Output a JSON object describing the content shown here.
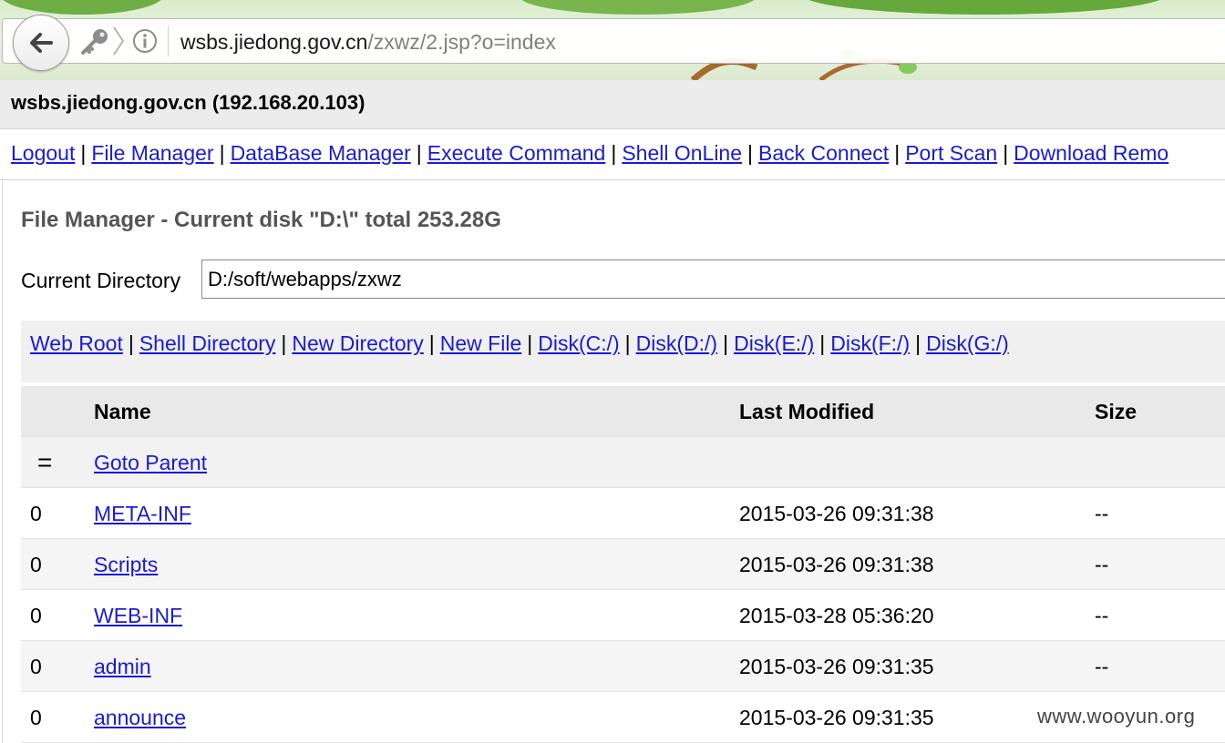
{
  "browser": {
    "url_host": "wsbs.jiedong.gov.cn",
    "url_path": "/zxwz/2.jsp?o=index"
  },
  "host_header": "wsbs.jiedong.gov.cn (192.168.20.103)",
  "nav": {
    "items": [
      "Logout",
      "File Manager",
      "DataBase Manager",
      "Execute Command",
      "Shell OnLine",
      "Back Connect",
      "Port Scan",
      "Download Remo"
    ],
    "separator": "|"
  },
  "file_manager": {
    "title": "File Manager - Current disk \"D:\\\" total 253.28G",
    "current_dir_label": "Current Directory",
    "current_dir_value": "D:/soft/webapps/zxwz",
    "quick_links": [
      "Web Root",
      "Shell Directory",
      "New Directory",
      "New File",
      "Disk(C:/)",
      "Disk(D:/)",
      "Disk(E:/)",
      "Disk(F:/)",
      "Disk(G:/)"
    ],
    "columns": {
      "name": "Name",
      "modified": "Last Modified",
      "size": "Size"
    },
    "parent": {
      "mark": "=",
      "label": "Goto Parent"
    },
    "rows": [
      {
        "mark": "0",
        "name": "META-INF",
        "modified": "2015-03-26 09:31:38",
        "size": "--"
      },
      {
        "mark": "0",
        "name": "Scripts",
        "modified": "2015-03-26 09:31:38",
        "size": "--"
      },
      {
        "mark": "0",
        "name": "WEB-INF",
        "modified": "2015-03-28 05:36:20",
        "size": "--"
      },
      {
        "mark": "0",
        "name": "admin",
        "modified": "2015-03-26 09:31:35",
        "size": "--"
      },
      {
        "mark": "0",
        "name": "announce",
        "modified": "2015-03-26 09:31:35",
        "size": ""
      }
    ]
  },
  "watermark": "www.wooyun.org",
  "icons": [
    "back-arrow-icon",
    "key-icon",
    "chevron-right-icon",
    "info-icon"
  ],
  "colors": {
    "link": "#1a1adb",
    "title_gray": "#555555",
    "header_bg": "#ececec"
  }
}
